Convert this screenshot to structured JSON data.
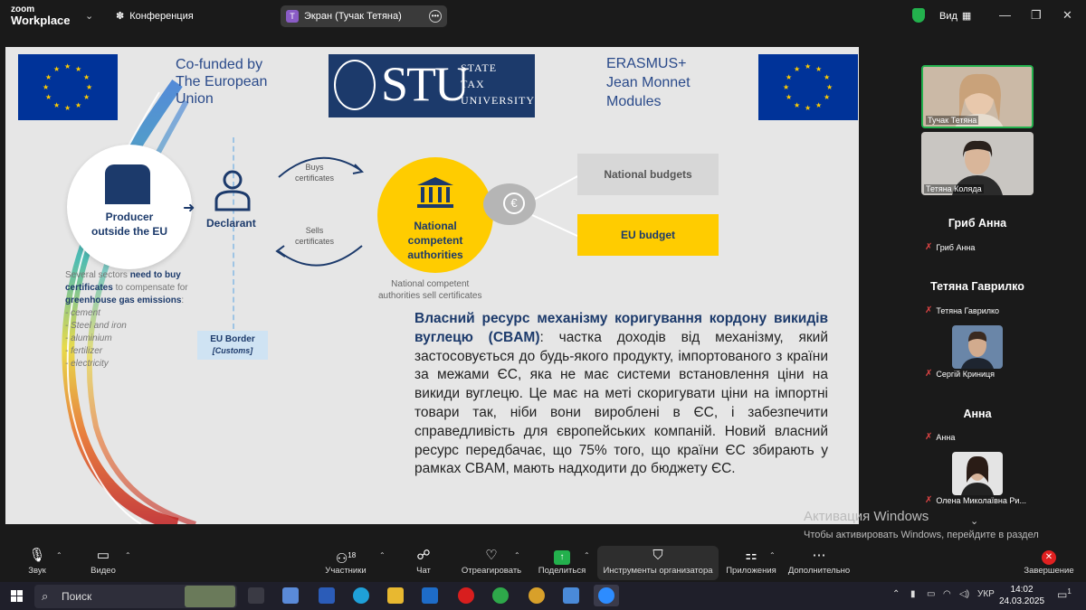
{
  "topbar": {
    "logo_line1": "zoom",
    "logo_line2": "Workplace",
    "conference_label": "Конференция",
    "screen_badge": "T",
    "screen_label": "Экран (Тучак Тетяна)",
    "view_label": "Вид"
  },
  "slide": {
    "cofunded": [
      "Co-funded by",
      "The European",
      "Union"
    ],
    "stu_big": "STU",
    "stu_lines": [
      "STATE",
      "TAX",
      "UNIVERSITY"
    ],
    "erasmus": [
      "ERASMUS+",
      "Jean Monnet",
      "Modules"
    ],
    "producer": [
      "Producer",
      "outside the EU"
    ],
    "declarant": "Declarant",
    "buys": [
      "Buys",
      "certificates"
    ],
    "sells": [
      "Sells",
      "certificates"
    ],
    "nca": [
      "National",
      "competent",
      "authorities"
    ],
    "national_budgets": "National budgets",
    "eu_budget": "EU budget",
    "nca_sell": [
      "National competent",
      "authorities sell certificates"
    ],
    "sectors_intro": "Several sectors",
    "sectors_bold1": "need to buy certificates",
    "sectors_mid": "to compensate for",
    "sectors_bold2": "greenhouse gas emissions",
    "sectors_colon": ":",
    "sectors": [
      "cement",
      "Steel and iron",
      "aluminium",
      "fertilizer",
      "electricity"
    ],
    "eu_border": "EU Border",
    "customs": "[Customs]",
    "para_bold": "Власний ресурс механізму коригування кордону викидів вуглецю (CBAM)",
    "para_rest": ": частка доходів від механізму, який застосовується до будь-якого продукту, імпортованого з країни за межами ЄС, яка не має системи встановлення ціни на викиди вуглецю. Це має на меті скоригувати ціни на імпортні товари так, ніби вони вироблені в ЄС, і забезпечити справедливість для європейських компаній. Новий власний ресурс передбачає, що 75% того, що країни ЄС збирають у рамках CBAM, мають надходити до бюджету ЄС."
  },
  "activation": {
    "title": "Активация Windows",
    "text": "Чтобы активировать Windows, перейдите в раздел \"Параметры\"."
  },
  "participants": [
    {
      "caption": "Тучак Тетяна",
      "kind": "video"
    },
    {
      "caption": "Тетяна Коляда",
      "kind": "video"
    },
    {
      "name": "Гриб Анна",
      "label": "Гриб Анна",
      "kind": "name"
    },
    {
      "name": "Тетяна Гаврилко",
      "label": "Тетяна Гаврилко",
      "kind": "name"
    },
    {
      "label": "Сергій Криниця",
      "kind": "avatar"
    },
    {
      "name": "Анна",
      "label": "Анна",
      "kind": "name"
    },
    {
      "label": "Олена Миколаївна Ри...",
      "kind": "avatar"
    }
  ],
  "toolbar": {
    "audio": "Звук",
    "video": "Видео",
    "participants": "Участники",
    "participants_count": "18",
    "chat": "Чат",
    "react": "Отреагировать",
    "share": "Поделиться",
    "host_tools": "Инструменты организатора",
    "apps": "Приложения",
    "more": "Дополнительно",
    "end": "Завершение"
  },
  "taskbar": {
    "search": "Поиск",
    "lang": "УКР",
    "time": "14:02",
    "date": "24.03.2025",
    "notif_count": "1"
  },
  "colors": {
    "eu_blue": "#003399",
    "eu_yellow": "#ffcc00",
    "navy": "#1c3a6b",
    "zoom_green": "#23b14d",
    "end_red": "#e02020"
  }
}
